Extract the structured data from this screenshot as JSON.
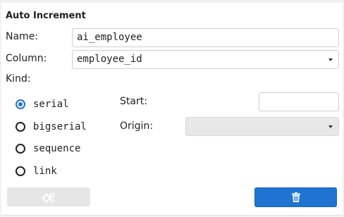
{
  "section": {
    "title": "Auto Increment"
  },
  "fields": {
    "name_label": "Name:",
    "name_value": "ai_employee",
    "column_label": "Column:",
    "column_value": "employee_id",
    "kind_label": "Kind:",
    "start_label": "Start:",
    "start_value": "",
    "origin_label": "Origin:",
    "origin_value": ""
  },
  "kind_options": [
    {
      "label": "serial",
      "checked": true
    },
    {
      "label": "bigserial",
      "checked": false
    },
    {
      "label": "sequence",
      "checked": false
    },
    {
      "label": "link",
      "checked": false
    }
  ],
  "buttons": {
    "settings_icon": "gears-icon",
    "delete_icon": "trash-icon"
  },
  "colors": {
    "accent": "#1f73d2",
    "disabled_button": "#e6e6e6"
  }
}
